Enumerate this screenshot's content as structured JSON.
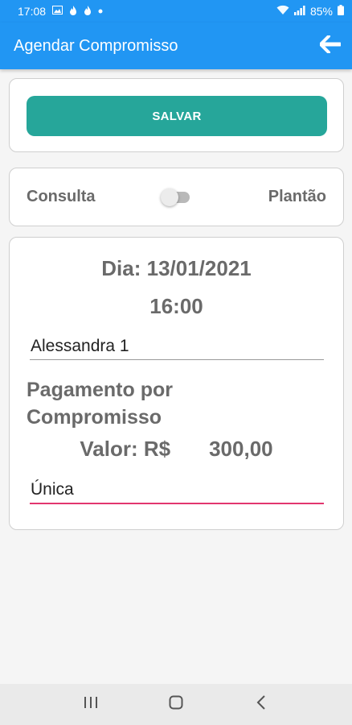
{
  "status_bar": {
    "time": "17:08",
    "battery": "85%"
  },
  "app_bar": {
    "title": "Agendar Compromisso"
  },
  "actions": {
    "save_label": "SALVAR"
  },
  "type_toggle": {
    "left_label": "Consulta",
    "right_label": "Plantão",
    "state": "off"
  },
  "appointment": {
    "date_text": "Dia: 13/01/2021",
    "time_text": "16:00",
    "name_value": "Alessandra 1",
    "payment_title": "Pagamento por Compromisso",
    "valor_label": "Valor: R$",
    "valor_amount": "300,00",
    "frequency_value": "Única"
  },
  "colors": {
    "primary": "#2196f3",
    "button": "#26a69a",
    "accent_underline": "#e2366f",
    "label_gray": "#6a6a6a"
  }
}
